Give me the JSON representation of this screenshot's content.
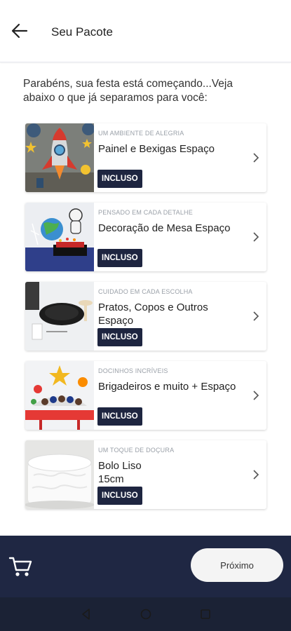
{
  "header": {
    "title": "Seu Pacote",
    "back_icon": "arrow-left-icon"
  },
  "intro": "Parabéns, sua festa está começando...Veja abaixo o que já separamos para você:",
  "items": [
    {
      "subtitle": "UM AMBIENTE DE ALEGRIA",
      "name": "Painel e Bexigas Espaço",
      "badge": "INCLUSO",
      "image": "space-rocket-panel"
    },
    {
      "subtitle": "PENSADO EM CADA DETALHE",
      "name": "Decoração de Mesa Espaço",
      "badge": "INCLUSO",
      "image": "space-table-decoration"
    },
    {
      "subtitle": "CUIDADO EM CADA ESCOLHA",
      "name": "Pratos, Copos e Outros Espaço",
      "badge": "INCLUSO",
      "image": "plates-and-cups"
    },
    {
      "subtitle": "DOCINHOS INCRÍVEIS",
      "name": "Brigadeiros e muito + Espaço",
      "badge": "INCLUSO",
      "image": "sweets-stand"
    },
    {
      "subtitle": "UM TOQUE DE DOÇURA",
      "name": "Bolo Liso\n15cm",
      "badge": "INCLUSO",
      "image": "white-cake"
    }
  ],
  "footer": {
    "next_label": "Próximo",
    "cart_icon": "cart-icon"
  },
  "colors": {
    "footer": "#1f2743",
    "badge": "#1e2540",
    "nav": "#1b2235"
  }
}
